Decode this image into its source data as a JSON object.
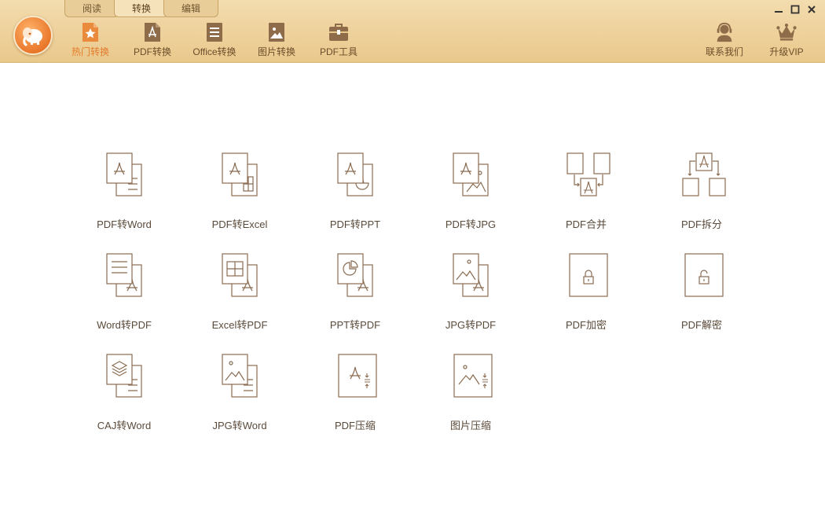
{
  "top_tabs": [
    {
      "label": "阅读",
      "active": false
    },
    {
      "label": "转换",
      "active": true
    },
    {
      "label": "编辑",
      "active": false
    }
  ],
  "toolbar": [
    {
      "label": "热门转换",
      "icon": "star-file-icon",
      "active": true
    },
    {
      "label": "PDF转换",
      "icon": "pdf-file-icon",
      "active": false
    },
    {
      "label": "Office转换",
      "icon": "doc-lines-icon",
      "active": false
    },
    {
      "label": "图片转换",
      "icon": "image-file-icon",
      "active": false
    },
    {
      "label": "PDF工具",
      "icon": "toolbox-icon",
      "active": false
    }
  ],
  "right_buttons": [
    {
      "label": "联系我们",
      "icon": "headset-icon"
    },
    {
      "label": "升级VIP",
      "icon": "crown-icon"
    }
  ],
  "window_controls": [
    "minimize-icon",
    "maximize-icon",
    "close-icon"
  ],
  "tools": [
    {
      "label": "PDF转Word",
      "icon": "pdf-to-word-icon"
    },
    {
      "label": "PDF转Excel",
      "icon": "pdf-to-excel-icon"
    },
    {
      "label": "PDF转PPT",
      "icon": "pdf-to-ppt-icon"
    },
    {
      "label": "PDF转JPG",
      "icon": "pdf-to-jpg-icon"
    },
    {
      "label": "PDF合并",
      "icon": "pdf-merge-icon"
    },
    {
      "label": "PDF拆分",
      "icon": "pdf-split-icon"
    },
    {
      "label": "Word转PDF",
      "icon": "word-to-pdf-icon"
    },
    {
      "label": "Excel转PDF",
      "icon": "excel-to-pdf-icon"
    },
    {
      "label": "PPT转PDF",
      "icon": "ppt-to-pdf-icon"
    },
    {
      "label": "JPG转PDF",
      "icon": "jpg-to-pdf-icon"
    },
    {
      "label": "PDF加密",
      "icon": "pdf-encrypt-icon"
    },
    {
      "label": "PDF解密",
      "icon": "pdf-decrypt-icon"
    },
    {
      "label": "CAJ转Word",
      "icon": "caj-to-word-icon"
    },
    {
      "label": "JPG转Word",
      "icon": "jpg-to-word-icon"
    },
    {
      "label": "PDF压缩",
      "icon": "pdf-compress-icon"
    },
    {
      "label": "图片压缩",
      "icon": "image-compress-icon"
    }
  ],
  "colors": {
    "titlebar": "#edd29d",
    "accent": "#e57b2c",
    "icon_stroke": "#8a6c52",
    "label": "#5a4a3a"
  }
}
